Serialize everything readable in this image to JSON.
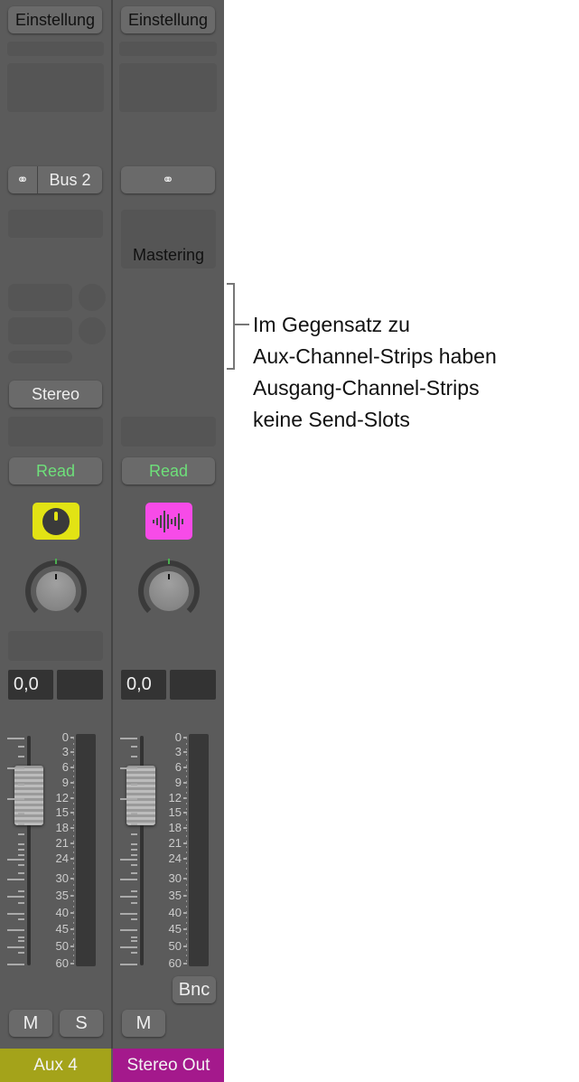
{
  "strips": [
    {
      "setting": "Einstellung",
      "link_icon": "stereo-link-icon",
      "input": "Bus 2",
      "output": "Stereo",
      "automation": "Read",
      "icon": "knob-icon",
      "icon_color": "#e2e314",
      "volume": "0,0",
      "mute": "M",
      "solo": "S",
      "name": "Aux 4",
      "name_color": "#a4a31a"
    },
    {
      "setting": "Einstellung",
      "link_icon": "stereo-link-icon",
      "insert": "Mastering",
      "automation": "Read",
      "icon": "waveform-icon",
      "icon_color": "#f74be8",
      "volume": "0,0",
      "bounce": "Bnc",
      "mute": "M",
      "name": "Stereo Out",
      "name_color": "#a4198c"
    }
  ],
  "meter_scale": [
    "0",
    "3",
    "6",
    "9",
    "12",
    "15",
    "18",
    "21",
    "24",
    "30",
    "35",
    "40",
    "45",
    "50",
    "60"
  ],
  "annotation": "Im Gegensatz zu Aux-Channel-Strips haben Ausgang-Channel-Strips keine Send-Slots",
  "annotation_lines": [
    "Im Gegensatz zu",
    "Aux-Channel-Strips haben",
    "Ausgang-Channel-Strips",
    "keine Send-Slots"
  ]
}
